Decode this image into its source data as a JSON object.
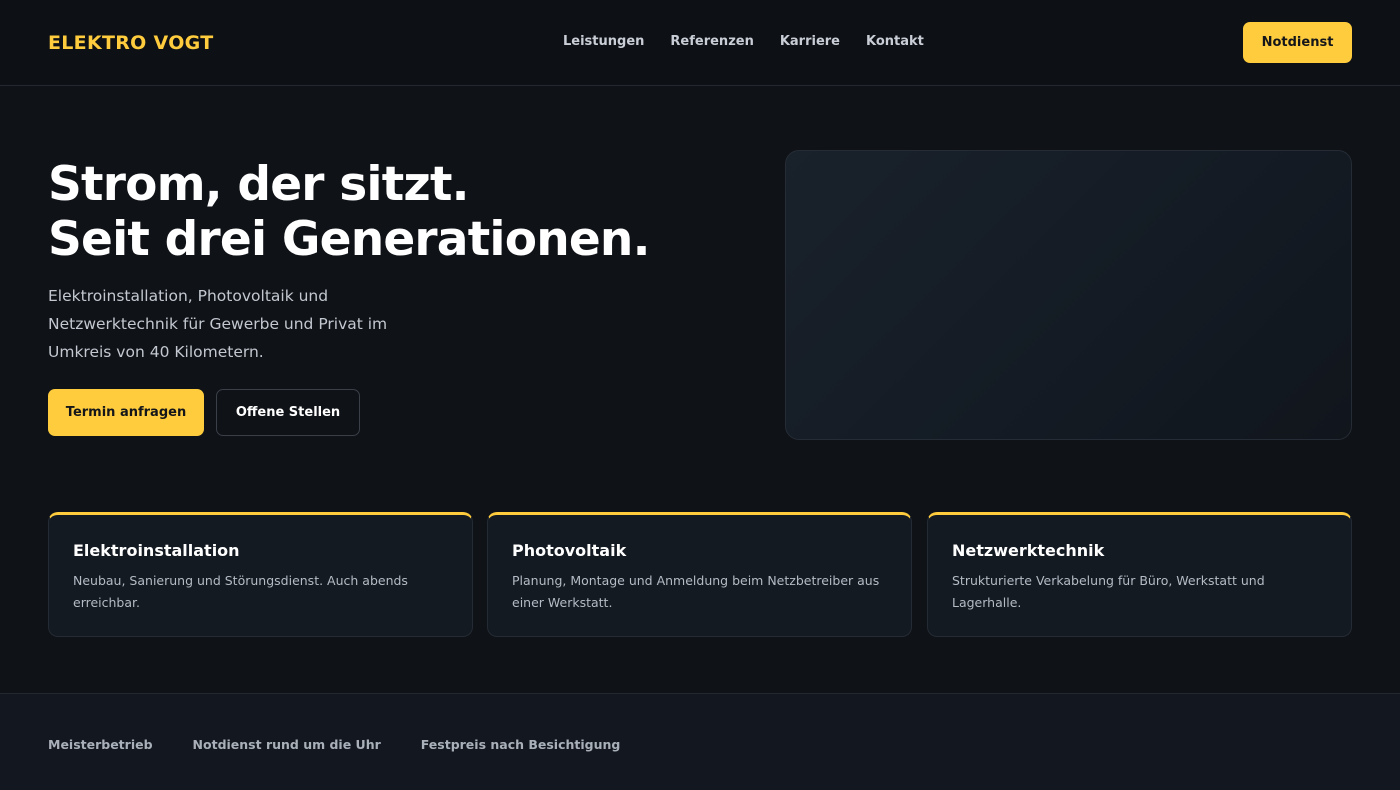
{
  "header": {
    "brand": "ELEKTRO VOGT",
    "nav": [
      "Leistungen",
      "Referenzen",
      "Karriere",
      "Kontakt"
    ],
    "cta_label": "Notdienst"
  },
  "hero": {
    "title_line1": "Strom, der sitzt.",
    "title_line2": "Seit drei Generationen.",
    "lede": "Elektroinstallation, Photovoltaik und Netzwerktechnik für Gewerbe und Privat im Umkreis von 40 Kilometern.",
    "primary_label": "Termin anfragen",
    "secondary_label": "Offene Stellen"
  },
  "services": [
    {
      "title": "Elektroinstallation",
      "text": "Neubau, Sanierung und Störungsdienst. Auch abends erreichbar."
    },
    {
      "title": "Photovoltaik",
      "text": "Planung, Montage und Anmeldung beim Netzbetreiber aus einer Werkstatt."
    },
    {
      "title": "Netzwerktechnik",
      "text": "Strukturierte Verkabelung für Büro, Werkstatt und Lagerhalle."
    }
  ],
  "footer": {
    "items": [
      "Meisterbetrieb",
      "Notdienst rund um die Uhr",
      "Festpreis nach Besichtigung"
    ]
  },
  "colors": {
    "accent": "#ffcc3d",
    "background": "#0f1217",
    "card": "#141a22"
  }
}
